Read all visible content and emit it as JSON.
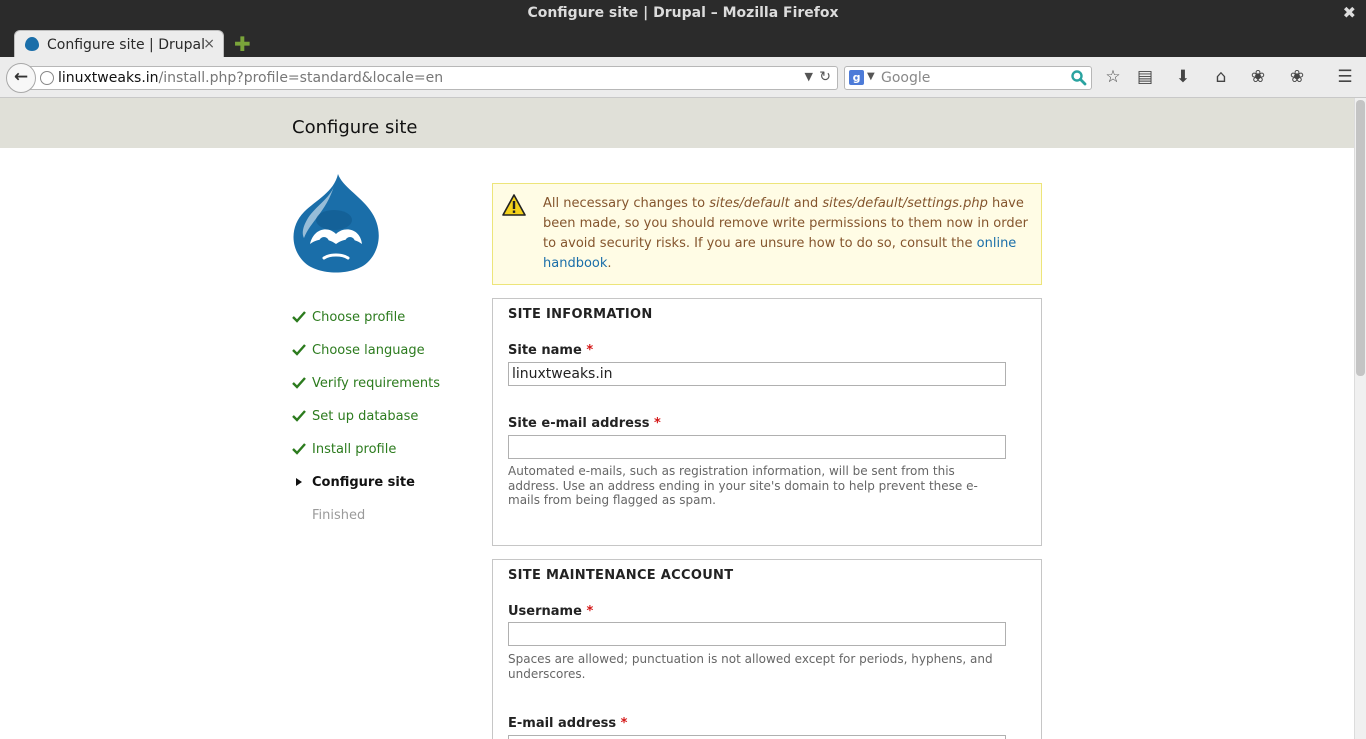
{
  "window": {
    "title": "Configure site | Drupal – Mozilla Firefox",
    "close_glyph": "✖"
  },
  "tab": {
    "label": "Configure site | Drupal",
    "close_glyph": "×",
    "new_tab_glyph": "✚"
  },
  "nav": {
    "back_glyph": "←",
    "url_host": "linuxtweaks.in",
    "url_path": "/install.php?profile=standard&locale=en",
    "url_dropdown_glyph": "▼",
    "reload_glyph": "↻",
    "search_engine_glyph": "g",
    "search_dropdown_glyph": "▼",
    "search_placeholder": "Google",
    "toolbar_glyphs": {
      "bookmark": "☆",
      "reader": "▤",
      "download": "⬇",
      "home": "⌂",
      "addon": "❀",
      "menu": "☰"
    }
  },
  "page": {
    "title": "Configure site"
  },
  "steps": [
    {
      "label": "Choose profile",
      "state": "done"
    },
    {
      "label": "Choose language",
      "state": "done"
    },
    {
      "label": "Verify requirements",
      "state": "done"
    },
    {
      "label": "Set up database",
      "state": "done"
    },
    {
      "label": "Install profile",
      "state": "done"
    },
    {
      "label": "Configure site",
      "state": "active"
    },
    {
      "label": "Finished",
      "state": "pending"
    }
  ],
  "warning": {
    "part1": "All necessary changes to ",
    "path1": "sites/default",
    "part2": " and ",
    "path2": "sites/default/settings.php",
    "part3": " have been made, so you should remove write permissions to them now in order to avoid security risks. If you are unsure how to do so, consult the ",
    "link": "online handbook",
    "part4": "."
  },
  "site_info": {
    "legend": "SITE INFORMATION",
    "site_name_label": "Site name",
    "site_name_value": "linuxtweaks.in",
    "email_label": "Site e-mail address",
    "email_value": "",
    "email_help": "Automated e-mails, such as registration information, will be sent from this address. Use an address ending in your site's domain to help prevent these e-mails from being flagged as spam.",
    "required_marker": "*"
  },
  "maintenance": {
    "legend": "SITE MAINTENANCE ACCOUNT",
    "username_label": "Username",
    "username_value": "",
    "username_help": "Spaces are allowed; punctuation is not allowed except for periods, hyphens, and underscores.",
    "email_label": "E-mail address",
    "required_marker": "*"
  },
  "colors": {
    "drupal_blue": "#1a6ea9",
    "step_done": "#2c7b1e",
    "required": "#d41717",
    "warning_bg": "#fffce5"
  }
}
